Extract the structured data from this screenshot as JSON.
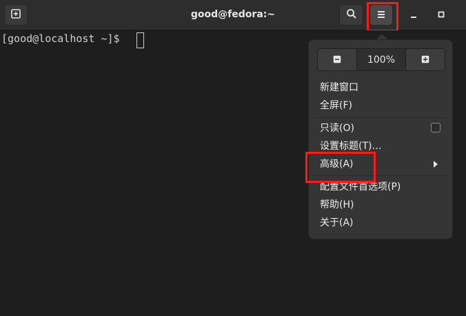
{
  "window": {
    "title": "good@fedora:~"
  },
  "headerbar": {
    "new_tab_icon": "new-tab-icon",
    "search_icon": "search-icon",
    "menu_icon": "hamburger-menu-icon",
    "minimize_icon": "minimize-icon",
    "maximize_icon": "maximize-icon"
  },
  "terminal": {
    "prompt": "[good@localhost ~]$ "
  },
  "menu": {
    "zoom": {
      "zoom_out_icon": "minus-icon",
      "value": "100%",
      "zoom_in_icon": "plus-icon"
    },
    "items": [
      {
        "label": "新建窗口"
      },
      {
        "label": "全屏(F)"
      },
      {
        "label": "只读(O)",
        "checked": false
      },
      {
        "label": "设置标题(T)…"
      },
      {
        "label": "高级(A)",
        "has_submenu": true
      },
      {
        "label": "配置文件首选项(P)"
      },
      {
        "label": "帮助(H)"
      },
      {
        "label": "关于(A)"
      }
    ]
  },
  "colors": {
    "highlight": "#ff1a1a",
    "background": "#1e1e1e",
    "headerbar": "#2d2d2d",
    "popover": "#353535"
  }
}
